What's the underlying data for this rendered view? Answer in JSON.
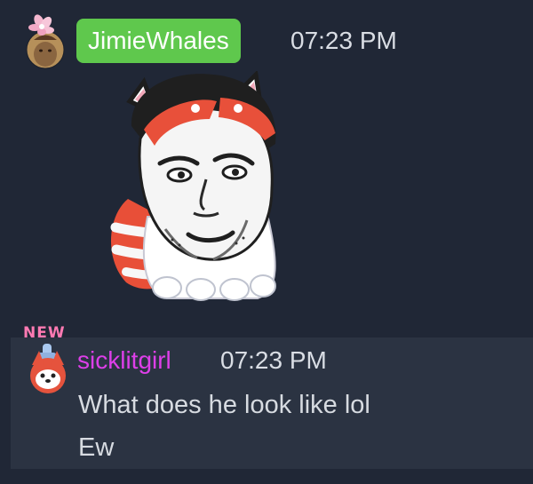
{
  "messages": [
    {
      "username": "JimieWhales",
      "timestamp": "07:23 PM",
      "name_color": "#5fc84d",
      "avatar_icon": "avatar-flower-crown-icon",
      "attachment": "sticker-red-panda-face"
    },
    {
      "badge": "NEW",
      "username": "sicklitgirl",
      "timestamp": "07:23 PM",
      "name_color": "#dd3fe8",
      "avatar_icon": "avatar-red-panda-icon",
      "lines": [
        "What does he look like lol",
        "Ew"
      ]
    }
  ],
  "colors": {
    "background": "#202736",
    "highlight_row": "#2b3342",
    "text": "#d7dbe1"
  }
}
